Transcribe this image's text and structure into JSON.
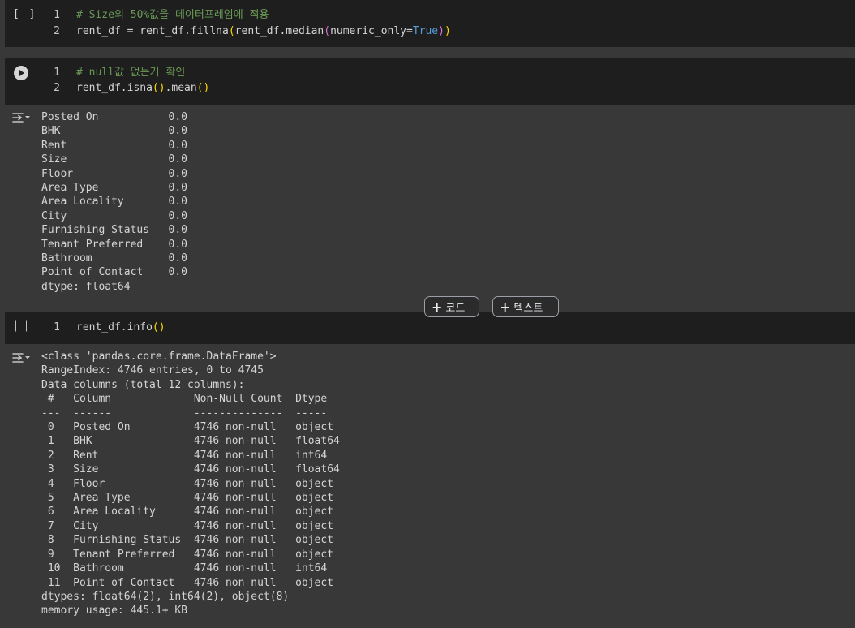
{
  "cells": [
    {
      "run_indicator": "[ ]",
      "lines": [
        {
          "num": "1",
          "comment": "# Size의 50%값을 데이터프레임에 적용"
        },
        {
          "num": "2",
          "code_pre": "rent_df = rent_df.fillna",
          "p1": "(",
          "code_mid": "rent_df.median",
          "p2": "(",
          "code_arg": "numeric_only=",
          "kw": "True",
          "p3": ")",
          "p4": ")"
        }
      ]
    },
    {
      "lines": [
        {
          "num": "1",
          "comment": "# null값 없는거 확인"
        },
        {
          "num": "2",
          "code_pre": "rent_df.isna",
          "p1": "()",
          "code_mid": ".mean",
          "p2": "()"
        }
      ],
      "output": "Posted On           0.0\nBHK                 0.0\nRent                0.0\nSize                0.0\nFloor               0.0\nArea Type           0.0\nArea Locality       0.0\nCity                0.0\nFurnishing Status   0.0\nTenant Preferred    0.0\nBathroom            0.0\nPoint of Contact    0.0\ndtype: float64"
    },
    {
      "lines": [
        {
          "num": "1",
          "code_pre": "rent_df.info",
          "p1": "()"
        }
      ],
      "output": "<class 'pandas.core.frame.DataFrame'>\nRangeIndex: 4746 entries, 0 to 4745\nData columns (total 12 columns):\n #   Column             Non-Null Count  Dtype  \n---  ------             --------------  -----  \n 0   Posted On          4746 non-null   object \n 1   BHK                4746 non-null   float64\n 2   Rent               4746 non-null   int64  \n 3   Size               4746 non-null   float64\n 4   Floor              4746 non-null   object \n 5   Area Type          4746 non-null   object \n 6   Area Locality      4746 non-null   object \n 7   City               4746 non-null   object \n 8   Furnishing Status  4746 non-null   object \n 9   Tenant Preferred   4746 non-null   object \n 10  Bathroom           4746 non-null   int64  \n 11  Point of Contact   4746 non-null   object \ndtypes: float64(2), int64(2), object(8)\nmemory usage: 445.1+ KB"
    }
  ],
  "toolbar": {
    "add_code_label": "코드",
    "add_text_label": "텍스트"
  }
}
